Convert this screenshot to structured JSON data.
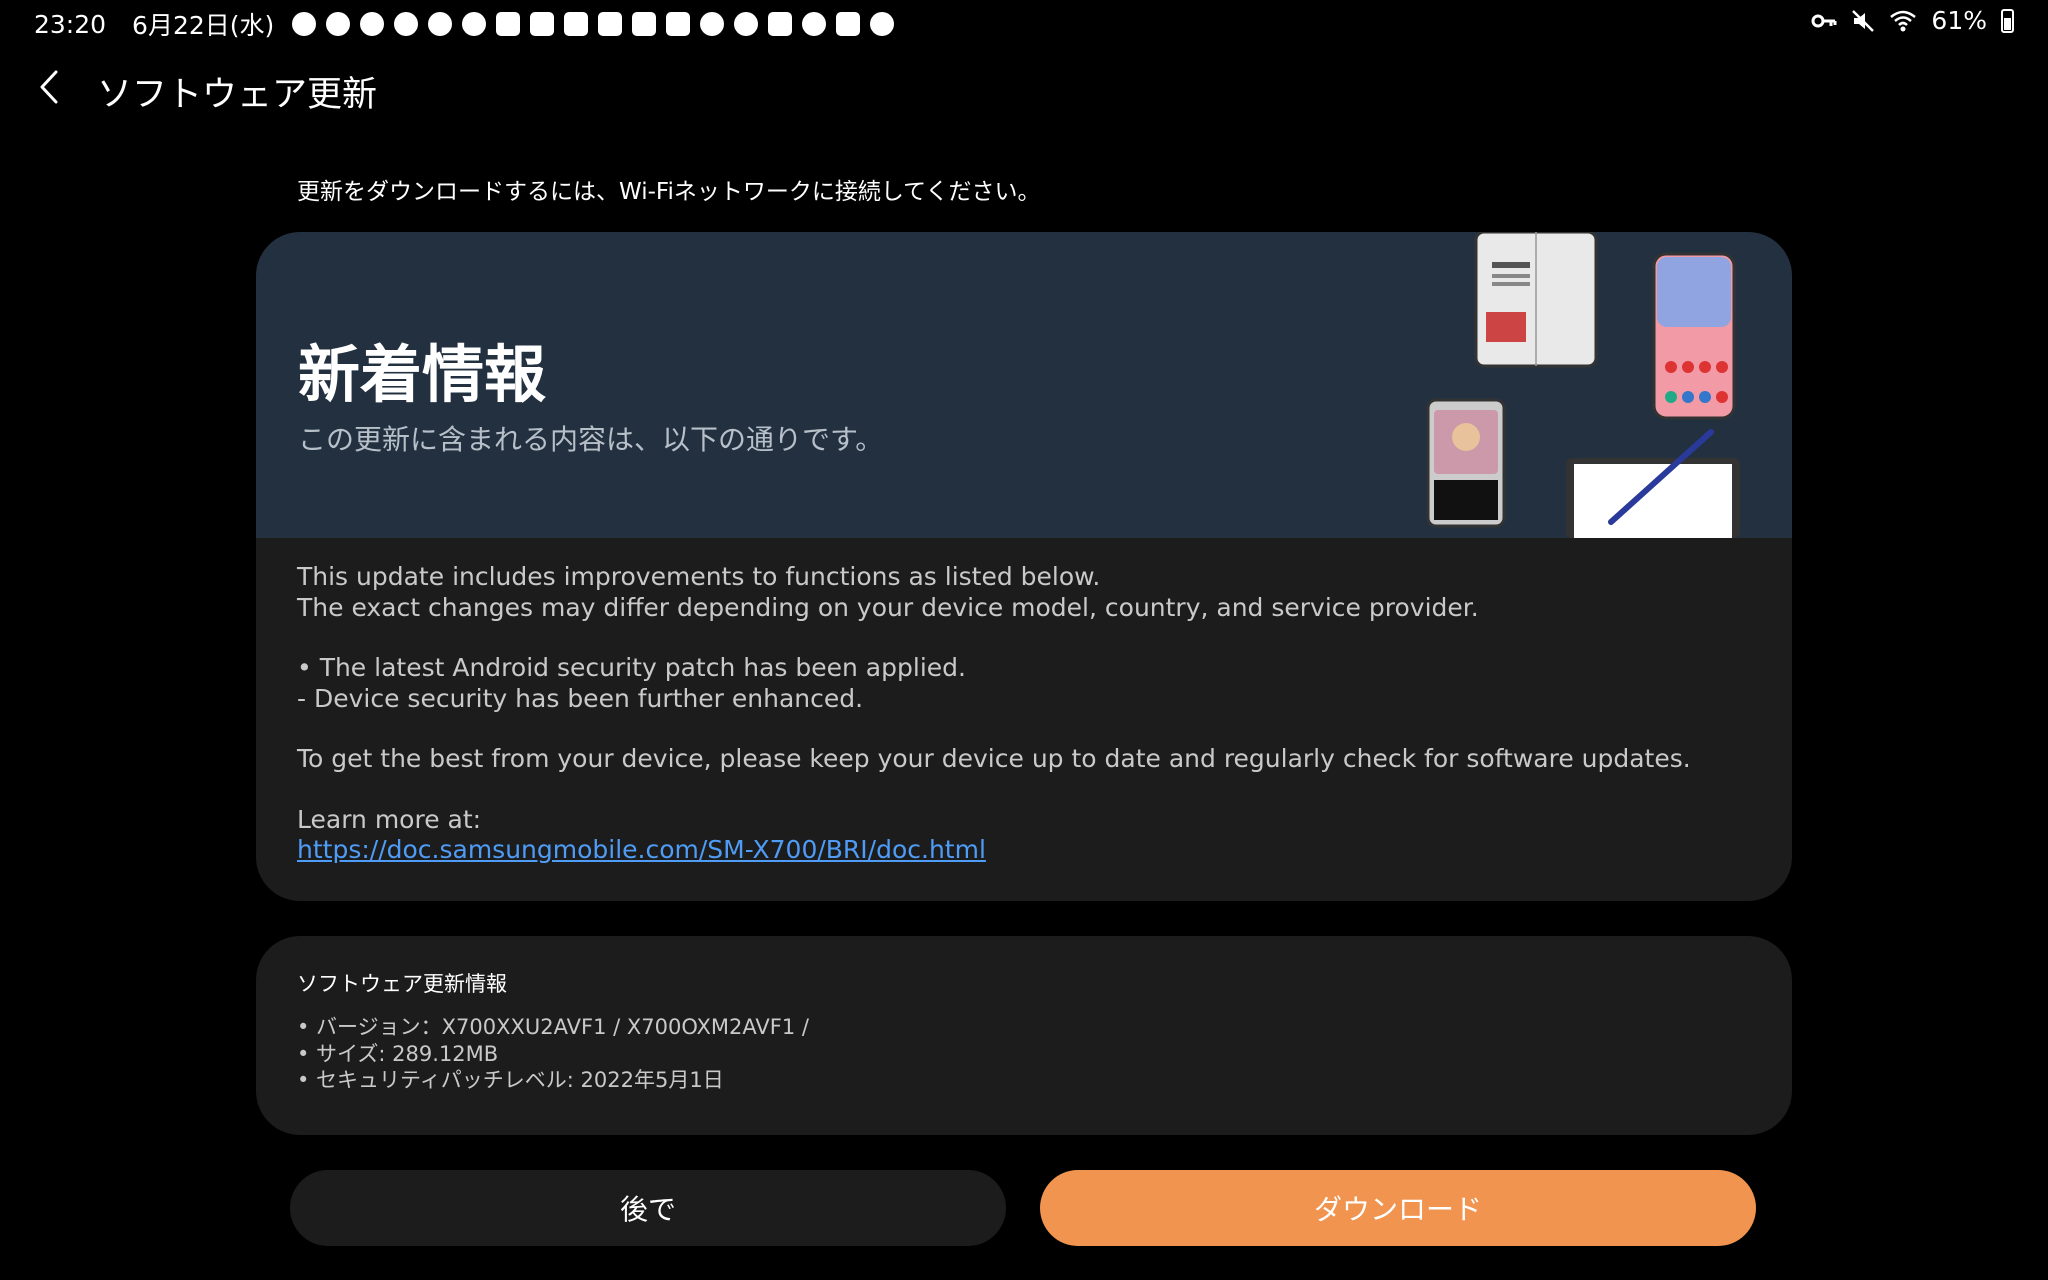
{
  "status_bar": {
    "time": "23:20",
    "date": "6月22日(水)",
    "battery": "61%",
    "notification_icons": [
      "cloud-icon",
      "cloud-icon",
      "cloud-icon",
      "cloud-icon",
      "cloud-icon",
      "cloud-icon",
      "youtube-icon",
      "youtube-icon",
      "youtube-icon",
      "youtube-icon",
      "check-icon",
      "mail-icon",
      "feather-icon",
      "music-icon",
      "crown-icon",
      "target-icon",
      "gmail-icon",
      "cloud-icon"
    ],
    "right_icons": [
      "key-icon",
      "mute-icon",
      "wifi-icon"
    ]
  },
  "header": {
    "title": "ソフトウェア更新"
  },
  "wifi_message": "更新をダウンロードするには、Wi-Fiネットワークに接続してください。",
  "whats_new": {
    "title": "新着情報",
    "subtitle": "この更新に含まれる内容は、以下の通りです。",
    "lines": [
      "This update includes improvements to functions as listed below.",
      "The exact changes may differ depending on your device model, country, and service provider.",
      "• The latest Android security patch has been applied.",
      "- Device security has been further enhanced.",
      "To get the best from your device, please keep your device up to date and regularly check for software updates.",
      "Learn more at:"
    ],
    "link": "https://doc.samsungmobile.com/SM-X700/BRI/doc.html"
  },
  "software_info": {
    "title": "ソフトウェア更新情報",
    "items": [
      "• バージョン：X700XXU2AVF1 / X700OXM2AVF1 /",
      "• サイズ: 289.12MB",
      "• セキュリティパッチレベル: 2022年5月1日"
    ]
  },
  "buttons": {
    "later": "後で",
    "download": "ダウンロード"
  },
  "colors": {
    "background": "#000000",
    "card": "#1c1c1c",
    "banner": "#223040",
    "accent": "#f0944f",
    "link": "#4f9cf6"
  }
}
